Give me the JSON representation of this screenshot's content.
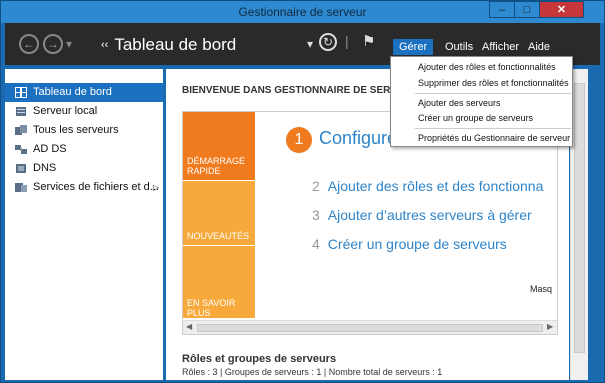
{
  "window": {
    "title": "Gestionnaire de serveur",
    "min_label": "‒",
    "max_label": "□",
    "close_label": "✕"
  },
  "header": {
    "breadcrumb_arrows": "‹‹",
    "breadcrumb": "Tableau de bord",
    "back_glyph": "←",
    "forward_glyph": "→",
    "refresh_glyph": "↻",
    "dropdown_glyph": "▾",
    "flag_glyph": "⚑",
    "menu": [
      "Gérer",
      "Outils",
      "Afficher",
      "Aide"
    ]
  },
  "sidebar": {
    "items": [
      {
        "label": "Tableau de bord",
        "icon": "dashboard-icon"
      },
      {
        "label": "Serveur local",
        "icon": "server-icon"
      },
      {
        "label": "Tous les serveurs",
        "icon": "servers-icon"
      },
      {
        "label": "AD DS",
        "icon": "ad-ds-icon"
      },
      {
        "label": "DNS",
        "icon": "dns-icon"
      },
      {
        "label": "Services de fichiers et d...",
        "icon": "file-services-icon",
        "expand": "▷"
      }
    ]
  },
  "main": {
    "welcome": "BIENVENUE DANS GESTIONNAIRE DE SERVE",
    "tiles": [
      "DÉMARRAGE RAPIDE",
      "NOUVEAUTÉS",
      "EN SAVOIR PLUS"
    ],
    "step1_num": "1",
    "step1": "Configure",
    "steps": [
      {
        "num": "2",
        "text": "Ajouter des rôles et des fonctionna"
      },
      {
        "num": "3",
        "text": "Ajouter d’autres serveurs à gérer"
      },
      {
        "num": "4",
        "text": "Créer un groupe de serveurs"
      }
    ],
    "masquer": "Masq",
    "roles_title": "Rôles et groupes de serveurs",
    "roles_info": "Rôles : 3  |  Groupes de serveurs : 1  |  Nombre total de serveurs : 1"
  },
  "dropdown": {
    "items": [
      "Ajouter des rôles et fonctionnalités",
      "Supprimer des rôles et fonctionnalités",
      "Ajouter des serveurs",
      "Créer un groupe de serveurs",
      "Propriétés du Gestionnaire de serveur"
    ]
  },
  "colors": {
    "accent": "#1c70c0",
    "tile_orange": "#f07a1e",
    "tile_amber": "#f7a93b",
    "link": "#2f84c8",
    "close": "#c7373a"
  }
}
